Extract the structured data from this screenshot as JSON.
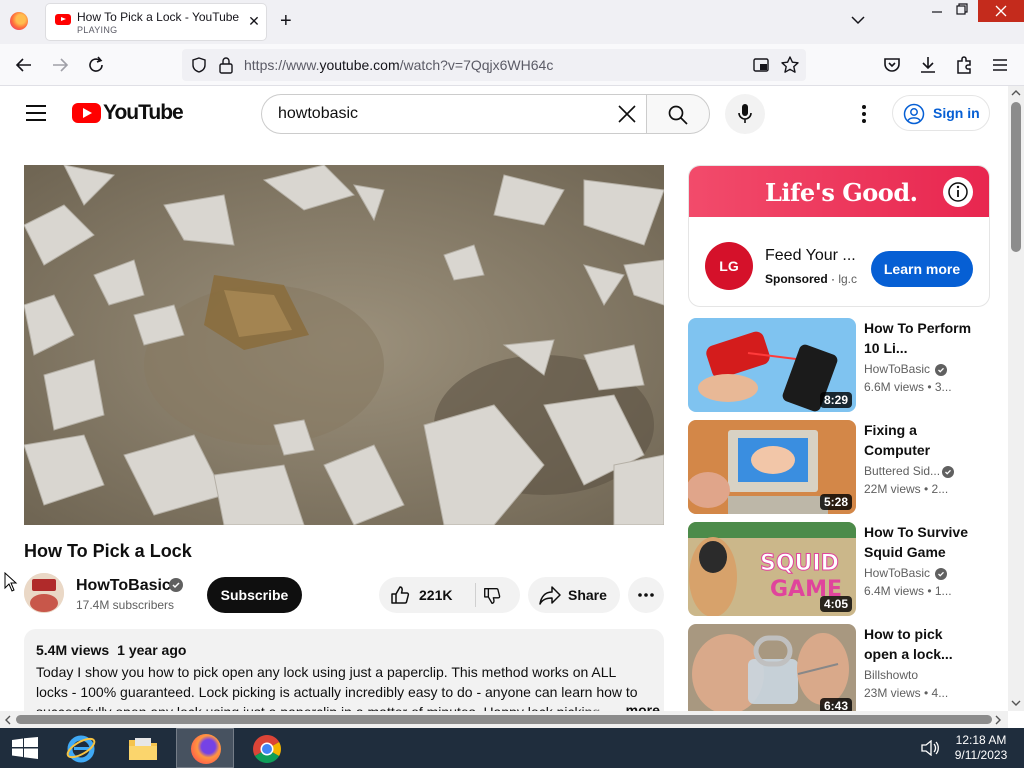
{
  "browser": {
    "tab": {
      "title": "How To Pick a Lock - YouTube",
      "status": "PLAYING"
    },
    "url": {
      "prefix": "https://www.",
      "domain": "youtube.com",
      "path": "/watch?v=7Qqjx6WH64c"
    }
  },
  "youtube": {
    "logo_text": "YouTube",
    "search": {
      "value": "howtobasic"
    },
    "signin_label": "Sign in",
    "video": {
      "title": "How To Pick a Lock",
      "channel": "HowToBasic",
      "subscribers": "17.4M subscribers",
      "subscribe_label": "Subscribe",
      "likes": "221K",
      "share_label": "Share",
      "views": "5.4M views",
      "age": "1 year ago",
      "description": "Today I show you how to pick open any lock using just a paperclip. This method works on ALL locks - 100% guaranteed. Lock picking is actually incredibly easy to do - anyone can learn how to successfully open any lock using just a paperclip in a matter of minutes. Happy lock picking...",
      "more_label": "...more",
      "avatar_text": "HOW TO BASIC"
    },
    "ad": {
      "tagline": "Life's Good.",
      "brand": "LG",
      "headline": "Feed Your ...",
      "sponsored": "Sponsored",
      "domain": "lg.c",
      "cta": "Learn more"
    },
    "recommendations": [
      {
        "title": "How To Perform 10 Li...",
        "channel": "HowToBasic",
        "meta": "6.6M views • 3...",
        "duration": "8:29",
        "verified": true
      },
      {
        "title": "Fixing a Computer",
        "channel": "Buttered Sid...",
        "meta": "22M views • 2...",
        "duration": "5:28",
        "verified": true
      },
      {
        "title": "How To Survive Squid Game",
        "channel": "HowToBasic",
        "meta": "6.4M views • 1...",
        "duration": "4:05",
        "verified": true
      },
      {
        "title": "How to pick open a lock...",
        "channel": "Billshowto",
        "meta": "23M views • 4...",
        "duration": "6:43",
        "verified": false
      }
    ]
  },
  "taskbar": {
    "time": "12:18 AM",
    "date": "9/11/2023"
  },
  "colors": {
    "brand_red": "#ff0000",
    "link_blue": "#065fd4",
    "lg_red": "#d5112a",
    "window_close": "#c42b1c"
  }
}
